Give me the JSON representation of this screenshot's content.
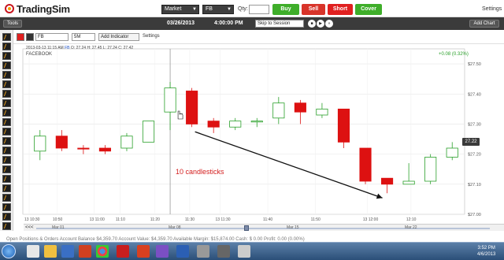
{
  "app": {
    "name": "TradingSim"
  },
  "toolbar": {
    "market_select": "Market",
    "symbol_select": "FB",
    "qty_label": "Qty:",
    "qty_value": "",
    "buy_label": "Buy",
    "sell_label": "Sell",
    "short_label": "Short",
    "cover_label": "Cover",
    "settings_label": "Settings"
  },
  "sessionbar": {
    "tools_label": "Tools",
    "date": "03/26/2013",
    "time": "4:00:00 PM",
    "skip_select": "Skip to Session",
    "add_chart_label": "Add Chart"
  },
  "chart_header": {
    "symbol_value": "FB",
    "interval_value": "5M",
    "add_indicator_label": "Add Indicator",
    "settings_label": "Settings"
  },
  "chart_info": {
    "info_prefix": "2013-03-13 11:15 AM",
    "info_symbol": "FB",
    "info_values": "O: 27.24  H: 27.45  L: 27.24  C: 27.42",
    "title": "FACEBOOK",
    "change": "+0.08 (0.32%)",
    "annotation": "10 candlesticks",
    "last_price": "27.22"
  },
  "chart_data": {
    "type": "candlestick",
    "title": "FACEBOOK",
    "ylim": [
      27.0,
      27.55
    ],
    "y_ticks": [
      "$27.50",
      "$27.40",
      "$27.30",
      "$27.20",
      "$27.10",
      "$27.00"
    ],
    "x_ticks": [
      "13 10:30",
      "10:50",
      "13 11:00",
      "11:10",
      "11:20",
      "11:30",
      "13 11:30",
      "11:40",
      "11:50",
      "13 12:00",
      "12:10"
    ],
    "candles": [
      {
        "open": 27.21,
        "high": 27.28,
        "low": 27.18,
        "close": 27.26,
        "color": "green"
      },
      {
        "open": 27.26,
        "high": 27.28,
        "low": 27.21,
        "close": 27.22,
        "color": "red"
      },
      {
        "open": 27.22,
        "high": 27.23,
        "low": 27.2,
        "close": 27.22,
        "color": "red"
      },
      {
        "open": 27.22,
        "high": 27.23,
        "low": 27.2,
        "close": 27.21,
        "color": "red"
      },
      {
        "open": 27.22,
        "high": 27.27,
        "low": 27.21,
        "close": 27.26,
        "color": "green"
      },
      {
        "open": 27.24,
        "high": 27.31,
        "low": 27.24,
        "close": 27.31,
        "color": "green"
      },
      {
        "open": 27.34,
        "high": 27.44,
        "low": 27.28,
        "close": 27.42,
        "color": "green"
      },
      {
        "open": 27.41,
        "high": 27.42,
        "low": 27.29,
        "close": 27.3,
        "color": "red"
      },
      {
        "open": 27.31,
        "high": 27.32,
        "low": 27.27,
        "close": 27.29,
        "color": "red"
      },
      {
        "open": 27.29,
        "high": 27.32,
        "low": 27.28,
        "close": 27.31,
        "color": "green"
      },
      {
        "open": 27.31,
        "high": 27.32,
        "low": 27.29,
        "close": 27.31,
        "color": "green"
      },
      {
        "open": 27.32,
        "high": 27.39,
        "low": 27.3,
        "close": 27.37,
        "color": "green"
      },
      {
        "open": 27.37,
        "high": 27.38,
        "low": 27.3,
        "close": 27.34,
        "color": "red"
      },
      {
        "open": 27.33,
        "high": 27.37,
        "low": 27.32,
        "close": 27.35,
        "color": "green"
      },
      {
        "open": 27.35,
        "high": 27.35,
        "low": 27.22,
        "close": 27.24,
        "color": "red"
      },
      {
        "open": 27.22,
        "high": 27.22,
        "low": 27.1,
        "close": 27.11,
        "color": "red"
      },
      {
        "open": 27.12,
        "high": 27.12,
        "low": 27.07,
        "close": 27.1,
        "color": "red"
      },
      {
        "open": 27.1,
        "high": 27.17,
        "low": 27.1,
        "close": 27.11,
        "color": "green"
      },
      {
        "open": 27.11,
        "high": 27.2,
        "low": 27.1,
        "close": 27.19,
        "color": "green"
      },
      {
        "open": 27.19,
        "high": 27.24,
        "low": 27.18,
        "close": 27.22,
        "color": "green"
      }
    ],
    "annotation_arrow": {
      "from_index": 7,
      "to_index": 16
    },
    "grid": true
  },
  "scrollbar": {
    "left_label": "<<<",
    "marks": [
      "Mar 01",
      "Mar 08",
      "Mar 15",
      "Mar 22"
    ]
  },
  "bottom_text": "Open Positions & Orders     Account Balance $4,359.70     Account Value: $4,359.70     Available Margin: $15,874.00     Cash: $ 0.00     Profit: 0.00 (0.00%)",
  "taskbar": {
    "time": "3:52 PM",
    "date": "4/6/2013"
  },
  "colors": {
    "bull": "#2aa02a",
    "bear": "#dd1111",
    "buy_btn": "#3fae2a",
    "sell_btn": "#d8342a",
    "short_btn": "#e02020",
    "cover_btn": "#3fae2a"
  }
}
